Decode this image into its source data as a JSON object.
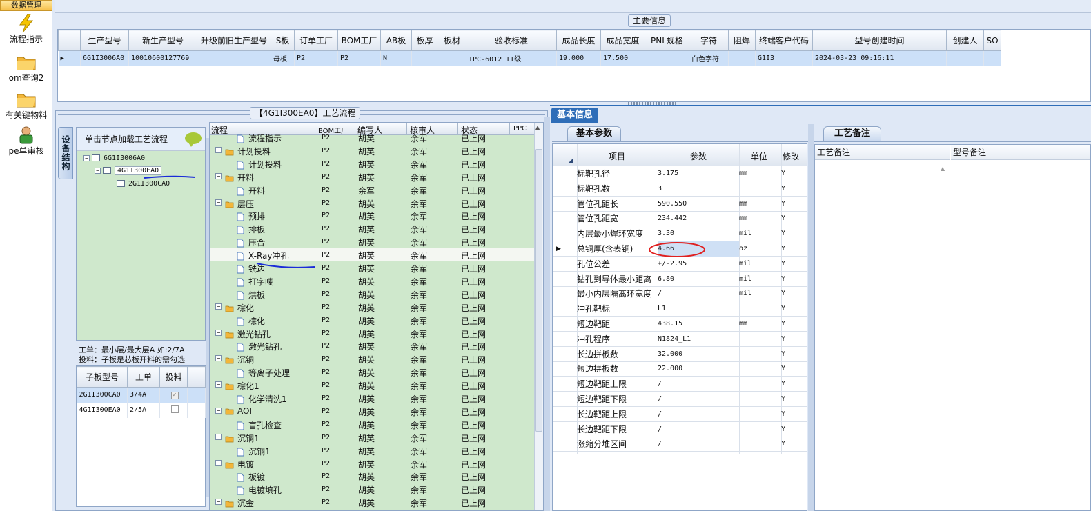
{
  "nav": {
    "header": "数据管理",
    "items": [
      "流程指示",
      "om查询2",
      "有关键物料",
      "pe单审核"
    ]
  },
  "main_info": {
    "group_title": "主要信息",
    "columns": [
      "生产型号",
      "新生产型号",
      "升级前旧生产型号",
      "S板",
      "订单工厂",
      "BOM工厂",
      "AB板",
      "板厚",
      "板材",
      "验收标准",
      "成品长度",
      "成品宽度",
      "PNL规格",
      "字符",
      "阻焊",
      "终端客户代码",
      "型号创建时间",
      "创建人",
      "SO"
    ],
    "row": [
      "6G1I3006A0",
      "10010600127769",
      "",
      "母板",
      "P2",
      "P2",
      "N",
      "",
      "",
      "IPC-6012 II级",
      "19.000",
      "17.500",
      "",
      "白色字符",
      "",
      "G1I3",
      "2024-03-23 09:16:11",
      "",
      ""
    ]
  },
  "left": {
    "vertical_tab": "设备结构",
    "tree_header": "单击节点加载工艺流程",
    "tree": [
      "6G1I3006A0",
      "4G1I300EA0",
      "2G1I300CA0"
    ],
    "note_line1": "工单：最小层/最大层A 如:2/7A",
    "note_line2": "投料：子板是芯板开料的需勾选",
    "sub_columns": [
      "子板型号",
      "工单",
      "投料"
    ],
    "sub_rows": [
      {
        "model": "2G1I300CA0",
        "order": "3/4A",
        "checked": true
      },
      {
        "model": "4G1I300EA0",
        "order": "2/5A",
        "checked": false
      }
    ]
  },
  "process": {
    "group_title": "【4G1I300EA0】工艺流程",
    "columns": [
      "流程",
      "BOM工厂",
      "编写人",
      "核审人",
      "状态",
      "PPC"
    ],
    "rows": [
      {
        "level": 2,
        "type": "doc",
        "name": "流程指示",
        "bom": "P2",
        "writer": "胡英",
        "checker": "余军",
        "status": "已上网"
      },
      {
        "level": 1,
        "type": "folder",
        "name": "计划投料",
        "bom": "P2",
        "writer": "胡英",
        "checker": "余军",
        "status": "已上网"
      },
      {
        "level": 2,
        "type": "doc",
        "name": "计划投料",
        "bom": "P2",
        "writer": "胡英",
        "checker": "余军",
        "status": "已上网"
      },
      {
        "level": 1,
        "type": "folder",
        "name": "开料",
        "bom": "P2",
        "writer": "胡英",
        "checker": "余军",
        "status": "已上网"
      },
      {
        "level": 2,
        "type": "doc",
        "name": "开料",
        "bom": "P2",
        "writer": "余军",
        "checker": "余军",
        "status": "已上网"
      },
      {
        "level": 1,
        "type": "folder",
        "name": "层压",
        "bom": "P2",
        "writer": "胡英",
        "checker": "余军",
        "status": "已上网"
      },
      {
        "level": 2,
        "type": "doc",
        "name": "预排",
        "bom": "P2",
        "writer": "胡英",
        "checker": "余军",
        "status": "已上网"
      },
      {
        "level": 2,
        "type": "doc",
        "name": "排板",
        "bom": "P2",
        "writer": "胡英",
        "checker": "余军",
        "status": "已上网"
      },
      {
        "level": 2,
        "type": "doc",
        "name": "压合",
        "bom": "P2",
        "writer": "胡英",
        "checker": "余军",
        "status": "已上网"
      },
      {
        "level": 2,
        "type": "doc",
        "name": "X-Ray冲孔",
        "bom": "P2",
        "writer": "胡英",
        "checker": "余军",
        "status": "已上网"
      },
      {
        "level": 2,
        "type": "doc",
        "name": "铣边",
        "bom": "P2",
        "writer": "胡英",
        "checker": "余军",
        "status": "已上网"
      },
      {
        "level": 2,
        "type": "doc",
        "name": "打字唛",
        "bom": "P2",
        "writer": "胡英",
        "checker": "余军",
        "status": "已上网"
      },
      {
        "level": 2,
        "type": "doc",
        "name": "烘板",
        "bom": "P2",
        "writer": "胡英",
        "checker": "余军",
        "status": "已上网"
      },
      {
        "level": 1,
        "type": "folder",
        "name": "棕化",
        "bom": "P2",
        "writer": "胡英",
        "checker": "余军",
        "status": "已上网"
      },
      {
        "level": 2,
        "type": "doc",
        "name": "棕化",
        "bom": "P2",
        "writer": "胡英",
        "checker": "余军",
        "status": "已上网"
      },
      {
        "level": 1,
        "type": "folder",
        "name": "激光钻孔",
        "bom": "P2",
        "writer": "胡英",
        "checker": "余军",
        "status": "已上网"
      },
      {
        "level": 2,
        "type": "doc",
        "name": "激光钻孔",
        "bom": "P2",
        "writer": "胡英",
        "checker": "余军",
        "status": "已上网"
      },
      {
        "level": 1,
        "type": "folder",
        "name": "沉铜",
        "bom": "P2",
        "writer": "胡英",
        "checker": "余军",
        "status": "已上网"
      },
      {
        "level": 2,
        "type": "doc",
        "name": "等离子处理",
        "bom": "P2",
        "writer": "胡英",
        "checker": "余军",
        "status": "已上网"
      },
      {
        "level": 1,
        "type": "folder",
        "name": "棕化1",
        "bom": "P2",
        "writer": "胡英",
        "checker": "余军",
        "status": "已上网"
      },
      {
        "level": 2,
        "type": "doc",
        "name": "化学清洗1",
        "bom": "P2",
        "writer": "胡英",
        "checker": "余军",
        "status": "已上网"
      },
      {
        "level": 1,
        "type": "folder",
        "name": "AOI",
        "bom": "P2",
        "writer": "胡英",
        "checker": "余军",
        "status": "已上网"
      },
      {
        "level": 2,
        "type": "doc",
        "name": "盲孔检查",
        "bom": "P2",
        "writer": "胡英",
        "checker": "余军",
        "status": "已上网"
      },
      {
        "level": 1,
        "type": "folder",
        "name": "沉铜1",
        "bom": "P2",
        "writer": "胡英",
        "checker": "余军",
        "status": "已上网"
      },
      {
        "level": 2,
        "type": "doc",
        "name": "沉铜1",
        "bom": "P2",
        "writer": "胡英",
        "checker": "余军",
        "status": "已上网"
      },
      {
        "level": 1,
        "type": "folder",
        "name": "电镀",
        "bom": "P2",
        "writer": "胡英",
        "checker": "余军",
        "status": "已上网"
      },
      {
        "level": 2,
        "type": "doc",
        "name": "板镀",
        "bom": "P2",
        "writer": "胡英",
        "checker": "余军",
        "status": "已上网"
      },
      {
        "level": 2,
        "type": "doc",
        "name": "电镀填孔",
        "bom": "P2",
        "writer": "胡英",
        "checker": "余军",
        "status": "已上网"
      },
      {
        "level": 1,
        "type": "folder",
        "name": "沉金",
        "bom": "P2",
        "writer": "胡英",
        "checker": "余军",
        "status": "已上网"
      }
    ]
  },
  "basic": {
    "tab": "基本信息",
    "subtab": "基本参数",
    "columns": [
      "项目",
      "参数",
      "单位",
      "修改"
    ],
    "rows": [
      {
        "item": "标靶孔径",
        "value": "3.175",
        "unit": "mm",
        "mod": "Y"
      },
      {
        "item": "标靶孔数",
        "value": "3",
        "unit": "",
        "mod": "Y"
      },
      {
        "item": "管位孔距长",
        "value": "590.550",
        "unit": "mm",
        "mod": "Y"
      },
      {
        "item": "管位孔距宽",
        "value": "234.442",
        "unit": "mm",
        "mod": "Y"
      },
      {
        "item": "内层最小焊环宽度",
        "value": "3.30",
        "unit": "mil",
        "mod": "Y"
      },
      {
        "item": "总铜厚(含表铜)",
        "value": "4.66",
        "unit": "oz",
        "mod": "Y"
      },
      {
        "item": "孔位公差",
        "value": "+/-2.95",
        "unit": "mil",
        "mod": "Y"
      },
      {
        "item": "钻孔到导体最小距离",
        "value": "6.80",
        "unit": "mil",
        "mod": "Y"
      },
      {
        "item": "最小内层隔离环宽度",
        "value": "/",
        "unit": "mil",
        "mod": "Y"
      },
      {
        "item": "冲孔靶标",
        "value": "L1",
        "unit": "",
        "mod": "Y"
      },
      {
        "item": "短边靶距",
        "value": "438.15",
        "unit": "mm",
        "mod": "Y"
      },
      {
        "item": "冲孔程序",
        "value": "N1824_L1",
        "unit": "",
        "mod": "Y"
      },
      {
        "item": "长边拼板数",
        "value": "32.000",
        "unit": "",
        "mod": "Y"
      },
      {
        "item": "短边拼板数",
        "value": "22.000",
        "unit": "",
        "mod": "Y"
      },
      {
        "item": "短边靶距上限",
        "value": "/",
        "unit": "",
        "mod": "Y"
      },
      {
        "item": "短边靶距下限",
        "value": "/",
        "unit": "",
        "mod": "Y"
      },
      {
        "item": "长边靶距上限",
        "value": "/",
        "unit": "",
        "mod": "Y"
      },
      {
        "item": "长边靶距下限",
        "value": "/",
        "unit": "",
        "mod": "Y"
      },
      {
        "item": "涨缩分堆区间",
        "value": "/",
        "unit": "",
        "mod": "Y"
      }
    ]
  },
  "remarks": {
    "tab": "工艺备注",
    "col1": "工艺备注",
    "col2": "型号备注"
  },
  "colors": {
    "grid_green": "#cfe8cc",
    "panel_blue": "#dfe8f6",
    "accent_blue": "#2e6db8",
    "annotation_red": "#e02020",
    "annotation_ink": "#1a2bd8"
  }
}
